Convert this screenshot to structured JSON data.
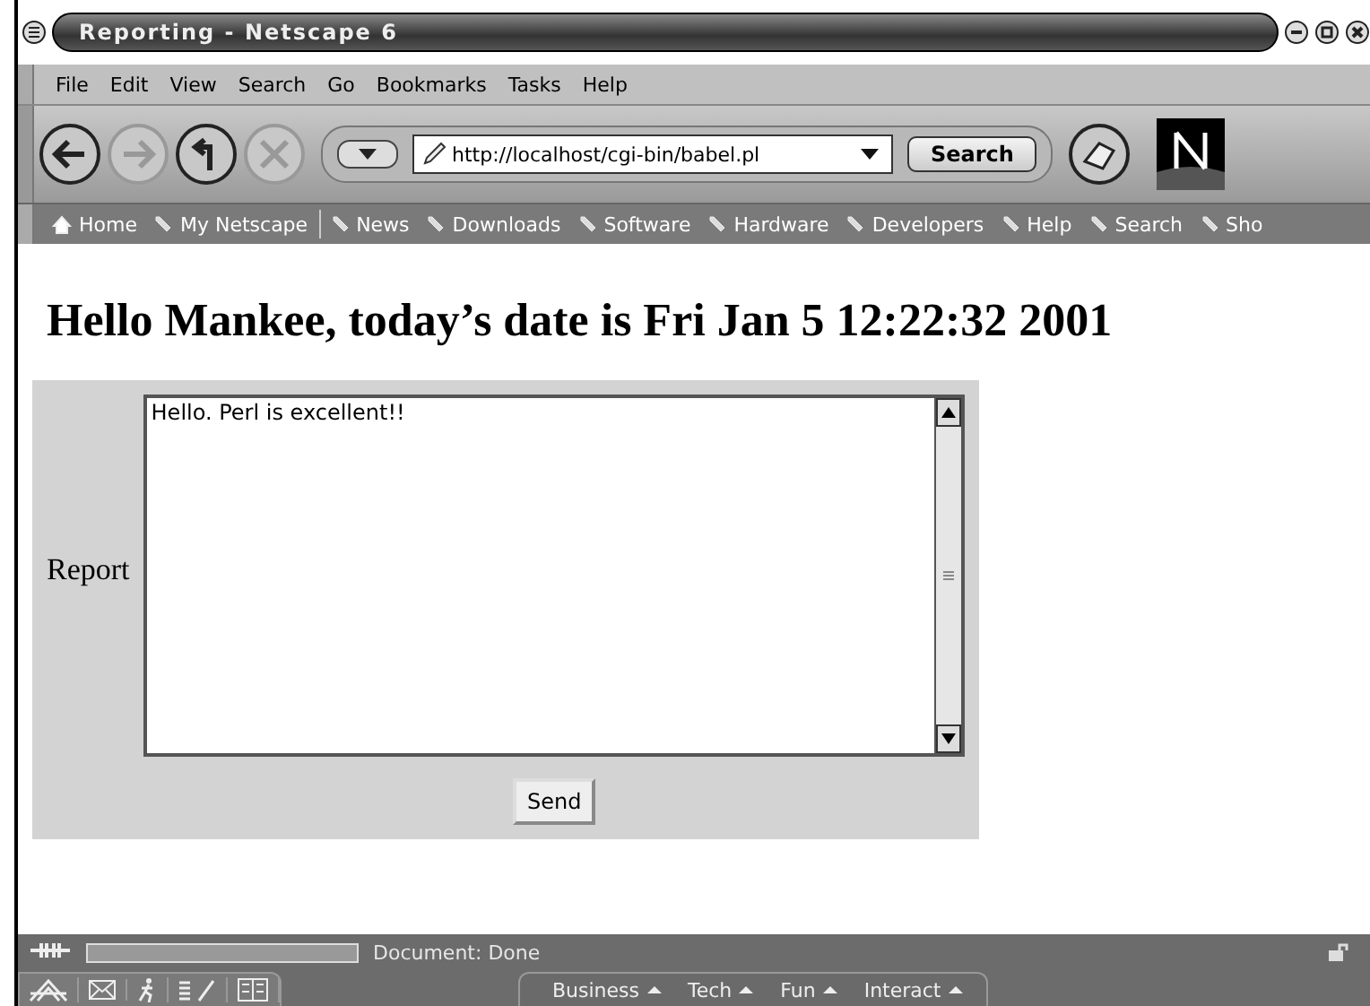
{
  "window": {
    "title": "Reporting - Netscape 6"
  },
  "menu": [
    "File",
    "Edit",
    "View",
    "Search",
    "Go",
    "Bookmarks",
    "Tasks",
    "Help"
  ],
  "nav_buttons": [
    {
      "kind": "back",
      "disabled": false
    },
    {
      "kind": "forward",
      "disabled": true
    },
    {
      "kind": "reload",
      "disabled": false
    },
    {
      "kind": "stop",
      "disabled": true
    }
  ],
  "address": {
    "value": "http://localhost/cgi-bin/babel.pl"
  },
  "search_button": "Search",
  "personal_toolbar": [
    {
      "kind": "home",
      "label": "Home"
    },
    {
      "kind": "bookmark",
      "label": "My Netscape"
    },
    {
      "kind": "bookmark",
      "label": "News"
    },
    {
      "kind": "bookmark",
      "label": "Downloads"
    },
    {
      "kind": "bookmark",
      "label": "Software"
    },
    {
      "kind": "bookmark",
      "label": "Hardware"
    },
    {
      "kind": "bookmark",
      "label": "Developers"
    },
    {
      "kind": "bookmark",
      "label": "Help"
    },
    {
      "kind": "bookmark",
      "label": "Search"
    },
    {
      "kind": "bookmark",
      "label": "Sho"
    }
  ],
  "page": {
    "heading": "Hello Mankee, today’s date is Fri Jan 5 12:22:32 2001",
    "form_label": "Report",
    "textarea": {
      "value": "Hello. Perl is excellent!!"
    },
    "button": "Send"
  },
  "status_bar": {
    "text": "Document: Done"
  },
  "taskbar_tabs": [
    "Business",
    "Tech",
    "Fun",
    "Interact"
  ]
}
